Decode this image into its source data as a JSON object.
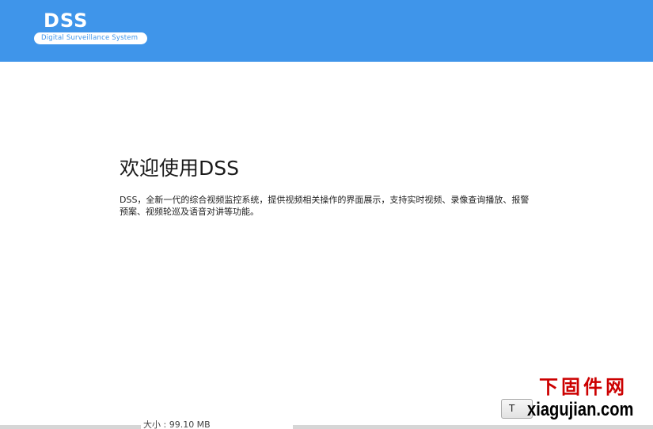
{
  "header": {
    "logo_title": "DSS",
    "logo_subtitle": "Digital Surveillance System"
  },
  "welcome": {
    "title": "欢迎使用DSS",
    "description": "DSS，全新一代的综合视频监控系统，提供视频相关操作的界面展示，支持实时视频、录像查询播放、报警预案、视频轮巡及语音对讲等功能。"
  },
  "bottom_bar": {
    "download_text": "大小  : 99.10 MB",
    "partial_button_label": "T"
  },
  "watermark": {
    "chinese": "下固件网",
    "url": "xiagujian.com"
  },
  "colors": {
    "header_bg": "#3f95ea",
    "logo_text": "#ffffff",
    "watermark_red": "#cc0000"
  }
}
